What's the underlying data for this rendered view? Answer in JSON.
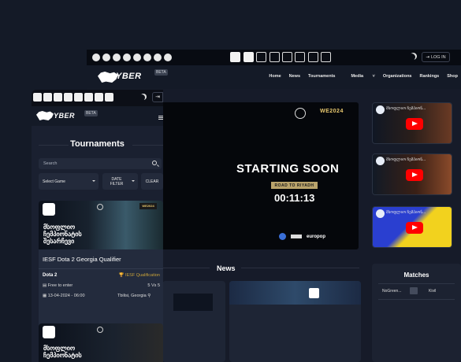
{
  "desktop": {
    "topbar": {
      "social_icons": [
        "twitter-icon",
        "facebook-icon",
        "youtube-icon",
        "discord-icon",
        "twitch-icon",
        "tiktok-icon",
        "instagram-icon",
        "other-icon"
      ],
      "game_icons": [
        "cs2-icon",
        "dota2-icon",
        "valorant-icon",
        "pubg-icon",
        "fifa-icon",
        "efootball-icon",
        "mobile-icon",
        "console-icon"
      ],
      "login_label": "LOG IN"
    },
    "nav": {
      "logo_text": "YBER",
      "beta": "BETA",
      "links": [
        "Home",
        "News",
        "Tournaments",
        "Media",
        "Organizations",
        "Rankings",
        "Shop"
      ]
    },
    "stream": {
      "title": "STARTING SOON",
      "subtitle": "ROAD TO RIYADH",
      "timer": "00:11:13",
      "event": "WE2024",
      "sponsors": [
        "europop"
      ]
    },
    "thumbnails": [
      {
        "channel": "მსოფლიო ჩემპიონ..."
      },
      {
        "channel": "მსოფლიო ჩემპიონ..."
      },
      {
        "channel": "მსოფლიო ჩემპიონ..."
      }
    ],
    "news_title": "News",
    "matches": {
      "title": "Matches",
      "rows": [
        {
          "team1": "NoGreen...",
          "team2": "Kivil"
        }
      ]
    }
  },
  "mobile": {
    "logo_text": "YBER",
    "beta": "BETA",
    "section_title": "Tournaments",
    "search_placeholder": "Search",
    "filters": {
      "game": "Select Game",
      "date": "DATE FILTER",
      "clear": "CLEAR"
    },
    "cards": [
      {
        "banner_text": "მსოფლიო ჩემპიონატის შესარჩევი",
        "name": "IESF Dota 2 Georgia Qualifier",
        "game": "Dota 2",
        "type": "IESF Qualification",
        "entry": "Free to enter",
        "format": "5 Vs 5",
        "date": "13-04-2024 - 06:00",
        "location": "Tbilisi, Georgia"
      },
      {
        "banner_text": "მსოფლიო ჩემპიონატის"
      }
    ]
  },
  "colors": {
    "background": "#141a27",
    "qualification_gold": "#c8a23a",
    "stream_gold": "#b9a36b",
    "youtube_red": "#ff0000"
  }
}
